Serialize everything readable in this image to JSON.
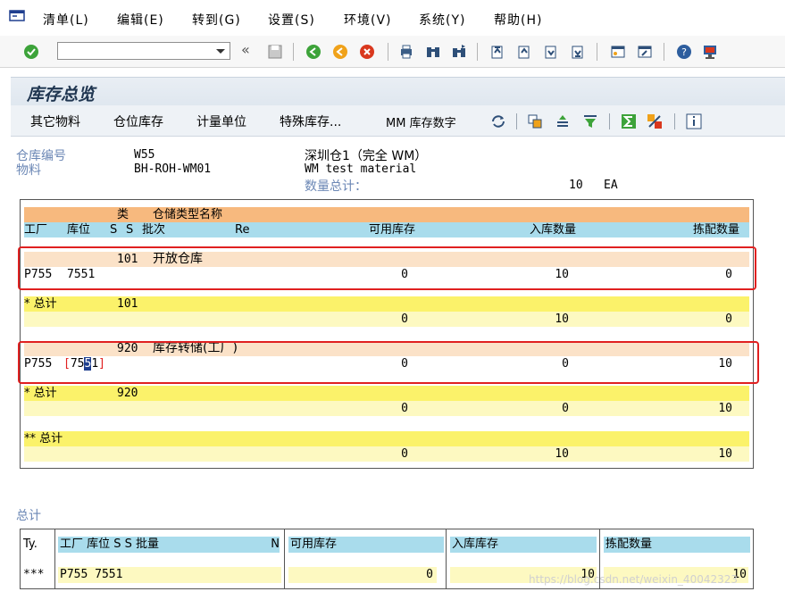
{
  "menu": {
    "items": [
      "清单(L)",
      "编辑(E)",
      "转到(G)",
      "设置(S)",
      "环境(V)",
      "系统(Y)",
      "帮助(H)"
    ]
  },
  "toolbar": {
    "command_value": "",
    "icons": [
      "enter-icon",
      "save-icon",
      "back-icon",
      "exit-icon",
      "cancel-icon",
      "print-icon",
      "find-icon",
      "find-next-icon",
      "first-page-icon",
      "prev-page-icon",
      "next-page-icon",
      "last-page-icon",
      "create-session-icon",
      "shortcut-icon",
      "help-icon",
      "customize-icon"
    ]
  },
  "title": "库存总览",
  "app_toolbar": {
    "other_material": "其它物料",
    "bin_stock": "仓位库存",
    "unit": "计量单位",
    "special_stock": "特殊库存...",
    "mm_stock": "MM 库存数字"
  },
  "header": {
    "warehouse_label": "仓库编号",
    "warehouse_value": "W55",
    "warehouse_desc": "深圳仓1（完全 WM）",
    "material_label": "物料",
    "material_value": "BH-ROH-WM01",
    "material_desc": "WM test material",
    "qty_total_label": "数量总计：",
    "qty_total_value": "10",
    "qty_total_unit": "EA"
  },
  "list": {
    "hdr1_cat": "类",
    "hdr1_name": "仓储类型名称",
    "hdr2_plant": "工厂",
    "hdr2_sloc": "库位",
    "hdr2_s1": "S",
    "hdr2_s2": "S",
    "hdr2_batch": "批次",
    "hdr2_re": "Re",
    "hdr2_avail": "可用库存",
    "hdr2_inbound": "入库数量",
    "hdr2_pick": "拣配数量",
    "group1_type": "101",
    "group1_name": "开放仓库",
    "group1_plant": "P755",
    "group1_sloc": "7551",
    "group1_avail": "0",
    "group1_inbound": "10",
    "group1_pick": "0",
    "sub1_label": "* 总计",
    "sub1_type": "101",
    "sub1_avail": "0",
    "sub1_inbound": "10",
    "sub1_pick": "0",
    "group2_type": "920",
    "group2_name": "库存转储(工厂)",
    "group2_plant": "P755",
    "group2_sloc_a": "75",
    "group2_sloc_b": "5",
    "group2_sloc_c": "1",
    "group2_avail": "0",
    "group2_inbound": "0",
    "group2_pick": "10",
    "sub2_label": "* 总计",
    "sub2_type": "920",
    "sub2_avail": "0",
    "sub2_inbound": "0",
    "sub2_pick": "10",
    "grand_label": "** 总计",
    "grand_avail": "0",
    "grand_inbound": "10",
    "grand_pick": "10"
  },
  "totals": {
    "section_label": "总计",
    "hdr_ty": "Ty.",
    "hdr_plant_batch": "工厂 库位 S S 批量",
    "hdr_n": "N",
    "hdr_avail": "可用库存",
    "hdr_inbound": "入库库存",
    "hdr_pick": "拣配数量",
    "row_ty": "***",
    "row_plant_sloc": "P755 7551",
    "row_avail": "0",
    "row_inbound": "10",
    "row_pick": "10"
  },
  "watermark": "https://blog.csdn.net/weixin_40042323",
  "colors": {
    "header_orange": "#f7b97e",
    "header_blue": "#a9dcec",
    "group_peach": "#fbe2c8",
    "subtotal_yellow": "#fbf26a",
    "subtotal_light": "#fdf9c1",
    "highlight_red": "#e02020"
  }
}
